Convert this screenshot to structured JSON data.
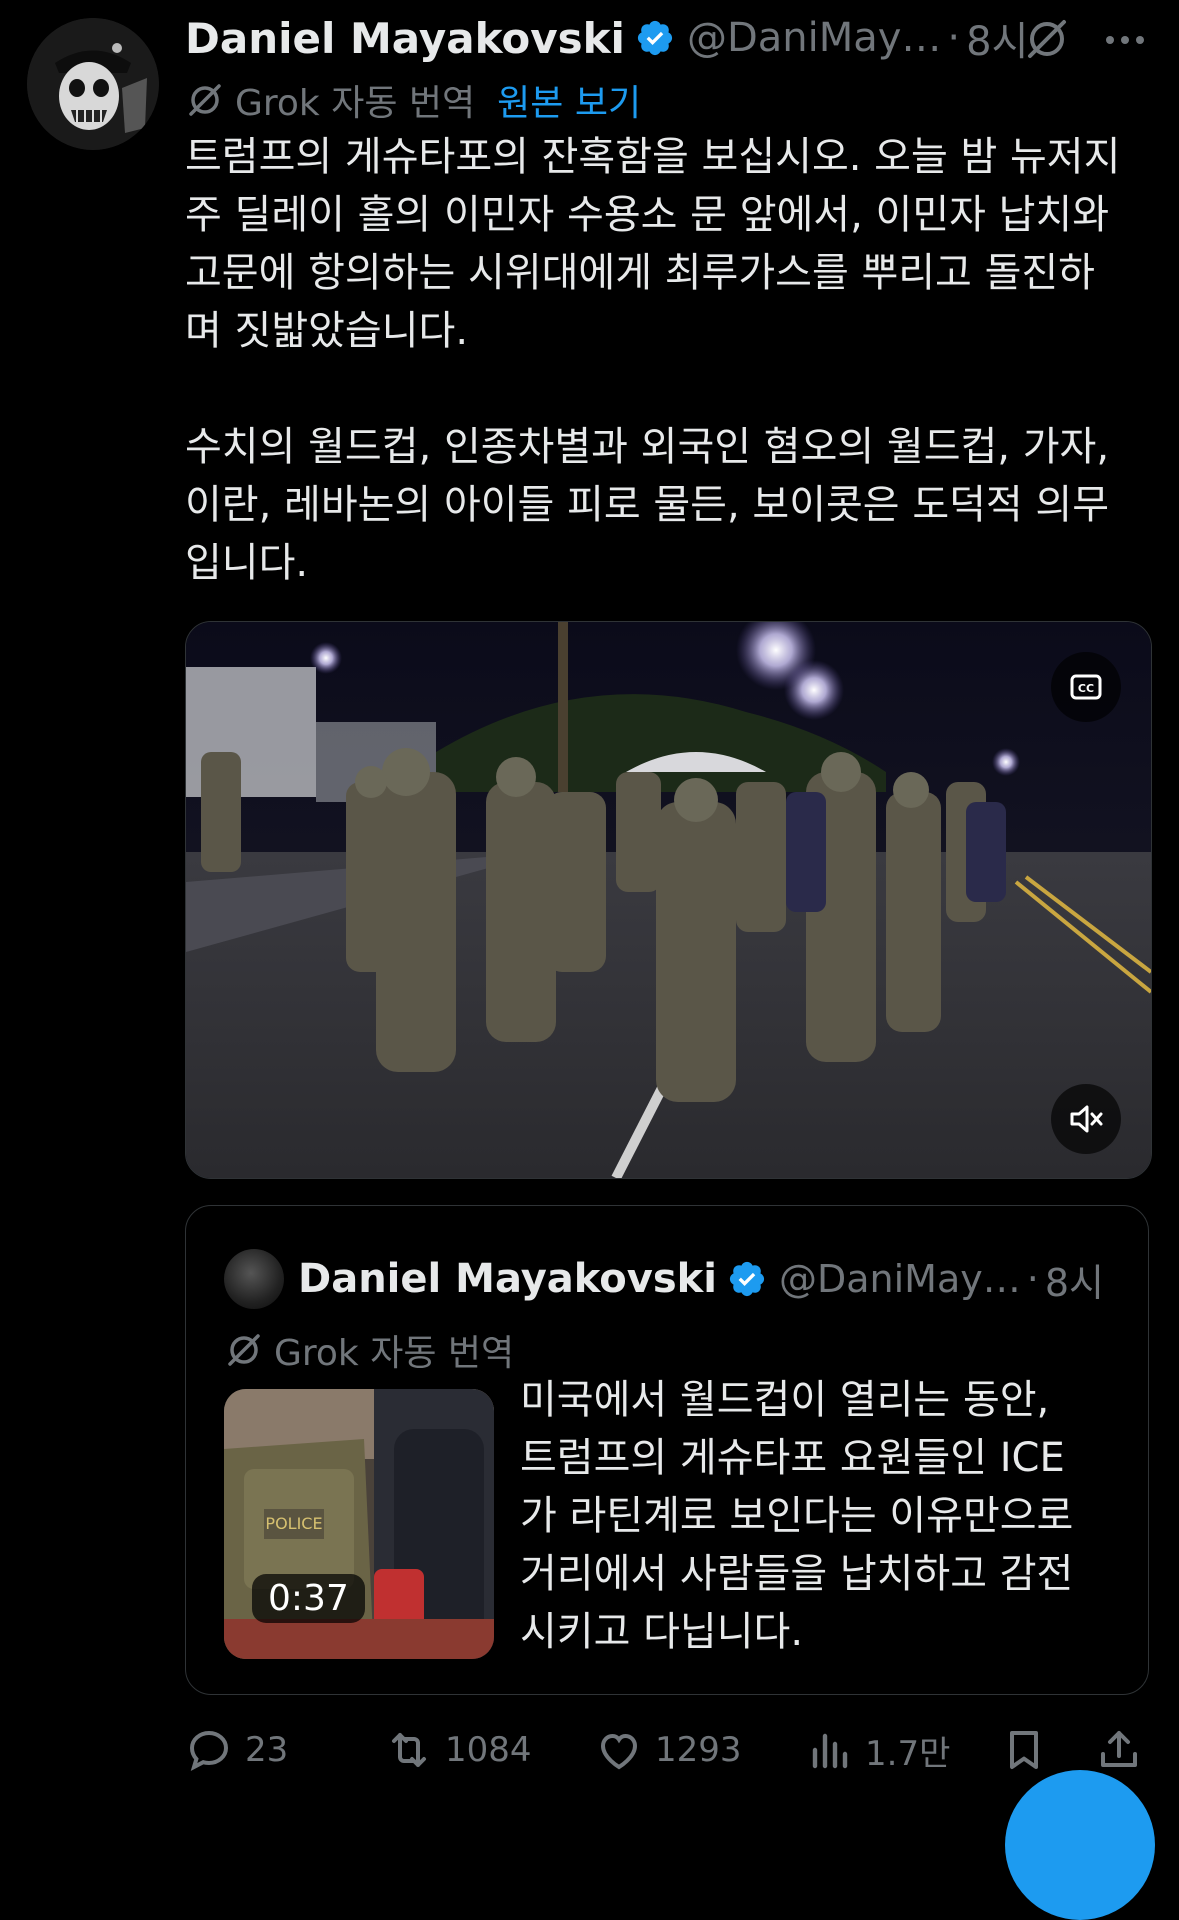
{
  "tweet": {
    "author_name": "Daniel Mayakovski",
    "handle": "@DaniMay…",
    "separator": "·",
    "time": "8시",
    "translation_label": "Grok 자동 번역",
    "view_original": "원본 보기",
    "body": "트럼프의 게슈타포의 잔혹함을 보십시오. 오늘 밤 뉴저지\n주 딜레이 홀의 이민자 수용소 문 앞에서, 이민자 납치와\n고문에 항의하는 시위대에게 최루가스를 뿌리고 돌진하\n며 짓밟았습니다.\n\n수치의 월드컵, 인종차별과 외국인 혐오의 월드컵, 가자,\n이란, 레바논의 아이들 피로 물든, 보이콧은 도덕적 의무\n입니다."
  },
  "quoted_tweet": {
    "author_name": "Daniel Mayakovski",
    "handle": "@DaniMay…",
    "separator": "·",
    "time": "8시",
    "translation_label": "Grok 자동 번역",
    "video_duration": "0:37",
    "body": "미국에서 월드컵이 열리는 동안,\n트럼프의 게슈타포 요원들인 ICE\n가 라틴계로 보인다는 이유만으로\n거리에서 사람들을 납치하고 감전\n시키고 다닙니다."
  },
  "actions": {
    "replies": "23",
    "reposts": "1084",
    "likes": "1293",
    "views": "1.7만"
  },
  "icons": {
    "verified": "verified-badge-icon",
    "grok": "grok-icon",
    "more": "more-icon",
    "cc": "closed-captions-icon",
    "mute": "mute-icon",
    "reply": "reply-icon",
    "repost": "repost-icon",
    "like": "like-icon",
    "views": "views-icon",
    "bookmark": "bookmark-icon",
    "share": "share-icon"
  },
  "colors": {
    "background": "#000000",
    "text": "#e7e9ea",
    "muted": "#71767b",
    "accent": "#1d9bf0"
  }
}
